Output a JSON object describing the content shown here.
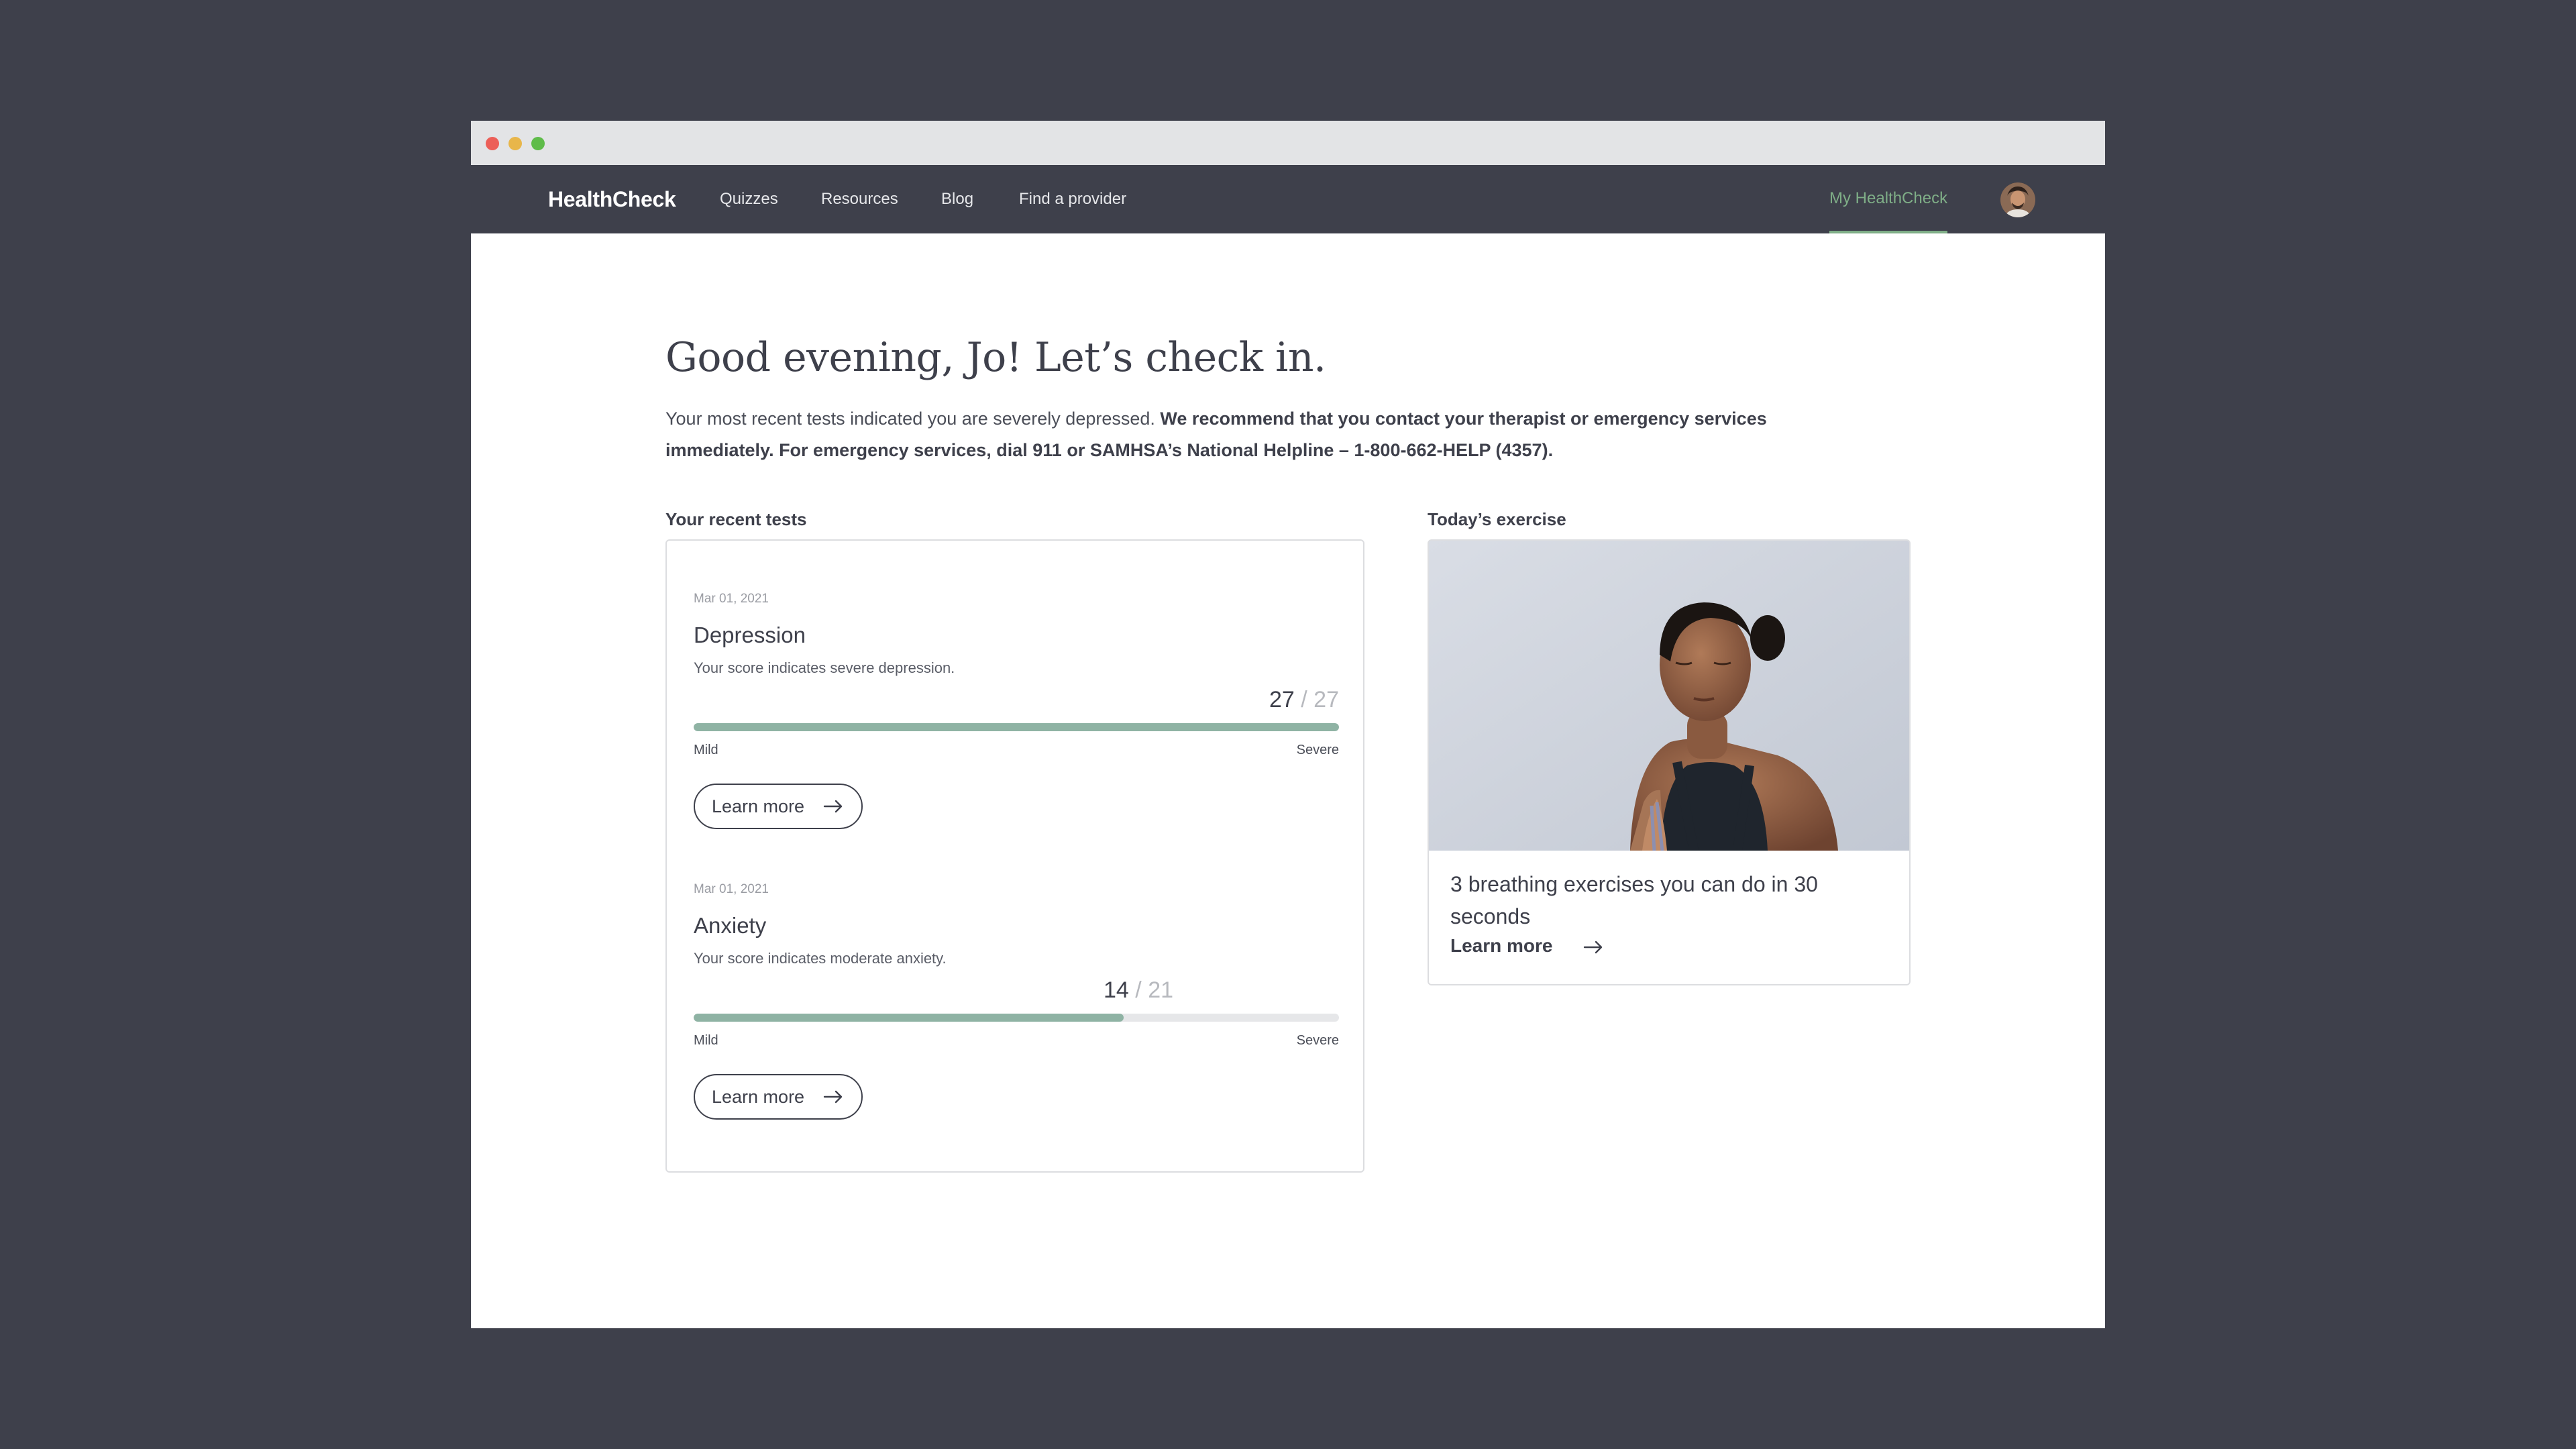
{
  "nav": {
    "brand": "HealthCheck",
    "links": [
      "Quizzes",
      "Resources",
      "Blog",
      "Find a provider"
    ],
    "my_link": "My HealthCheck",
    "accent_color": "#7fae87"
  },
  "main": {
    "greeting": "Good evening, Jo! Let’s check in.",
    "message_plain": "Your most recent tests indicated you are severely depressed.",
    "message_bold": "We recommend that you contact your therapist or emergency services immediately. For emergency services, dial 911 or SAMHSA’s National Helpline – 1-800-662-HELP (4357)."
  },
  "recent_tests": {
    "title": "Your recent tests",
    "items": [
      {
        "date": "Mar 01, 2021",
        "name": "Depression",
        "description": "Your score indicates severe depression.",
        "score": "27",
        "max": "27",
        "separator": "/",
        "min_label": "Mild",
        "max_label": "Severe",
        "button": "Learn more"
      },
      {
        "date": "Mar 01, 2021",
        "name": "Anxiety",
        "description": "Your score indicates moderate anxiety.",
        "score": "14",
        "max": "21",
        "separator": "/",
        "min_label": "Mild",
        "max_label": "Severe",
        "button": "Learn more"
      }
    ],
    "bar_color": "#8fb3a4"
  },
  "exercise": {
    "title": "Today’s exercise",
    "card_title": "3 breathing exercises you can do in 30 seconds",
    "link": "Learn more",
    "image": "woman-meditating-photo"
  }
}
